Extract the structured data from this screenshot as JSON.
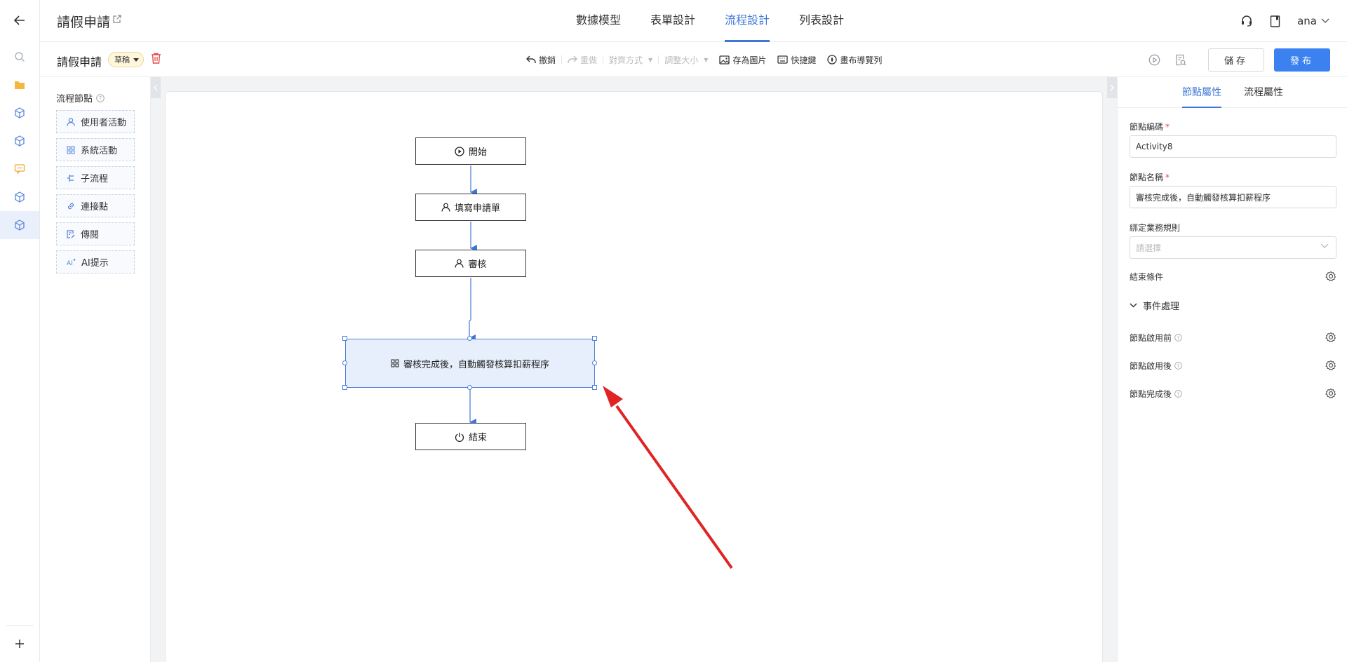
{
  "header": {
    "title": "請假申請",
    "tabs": [
      "數據模型",
      "表單設計",
      "流程設計",
      "列表設計"
    ],
    "active_tab": 2,
    "user": "ana"
  },
  "toolbar": {
    "page_name": "請假申請",
    "status": "草稿",
    "undo": "撤銷",
    "redo": "重做",
    "align": "對齊方式",
    "resize": "調整大小",
    "save_image": "存為圖片",
    "shortcut": "快捷鍵",
    "canvas_nav": "畫布導覽列",
    "save_btn": "儲存",
    "publish_btn": "發布"
  },
  "palette": {
    "title": "流程節點",
    "items": [
      "使用者活動",
      "系統活動",
      "子流程",
      "連接點",
      "傳閱",
      "AI提示"
    ]
  },
  "flow": {
    "nodes": {
      "start": "開始",
      "fill_form": "填寫申請單",
      "review": "審核",
      "auto": "審核完成後，自動觸發核算扣薪程序",
      "end": "結束"
    }
  },
  "properties": {
    "tabs": [
      "節點屬性",
      "流程屬性"
    ],
    "active_tab": 0,
    "code_label": "節點編碼",
    "code_value": "Activity8",
    "name_label": "節點名稱",
    "name_value": "審核完成後，自動觸發核算扣薪程序",
    "rule_label": "綁定業務規則",
    "rule_placeholder": "請選擇",
    "end_condition": "結束條件",
    "event_section": "事件處理",
    "before_enable": "節點啟用前",
    "after_enable": "節點啟用後",
    "after_complete": "節點完成後"
  },
  "colors": {
    "accent": "#3f77d6",
    "primary_button": "#3b82f0",
    "selected_node_fill": "#e6effb",
    "annotation_arrow": "#e02424"
  }
}
